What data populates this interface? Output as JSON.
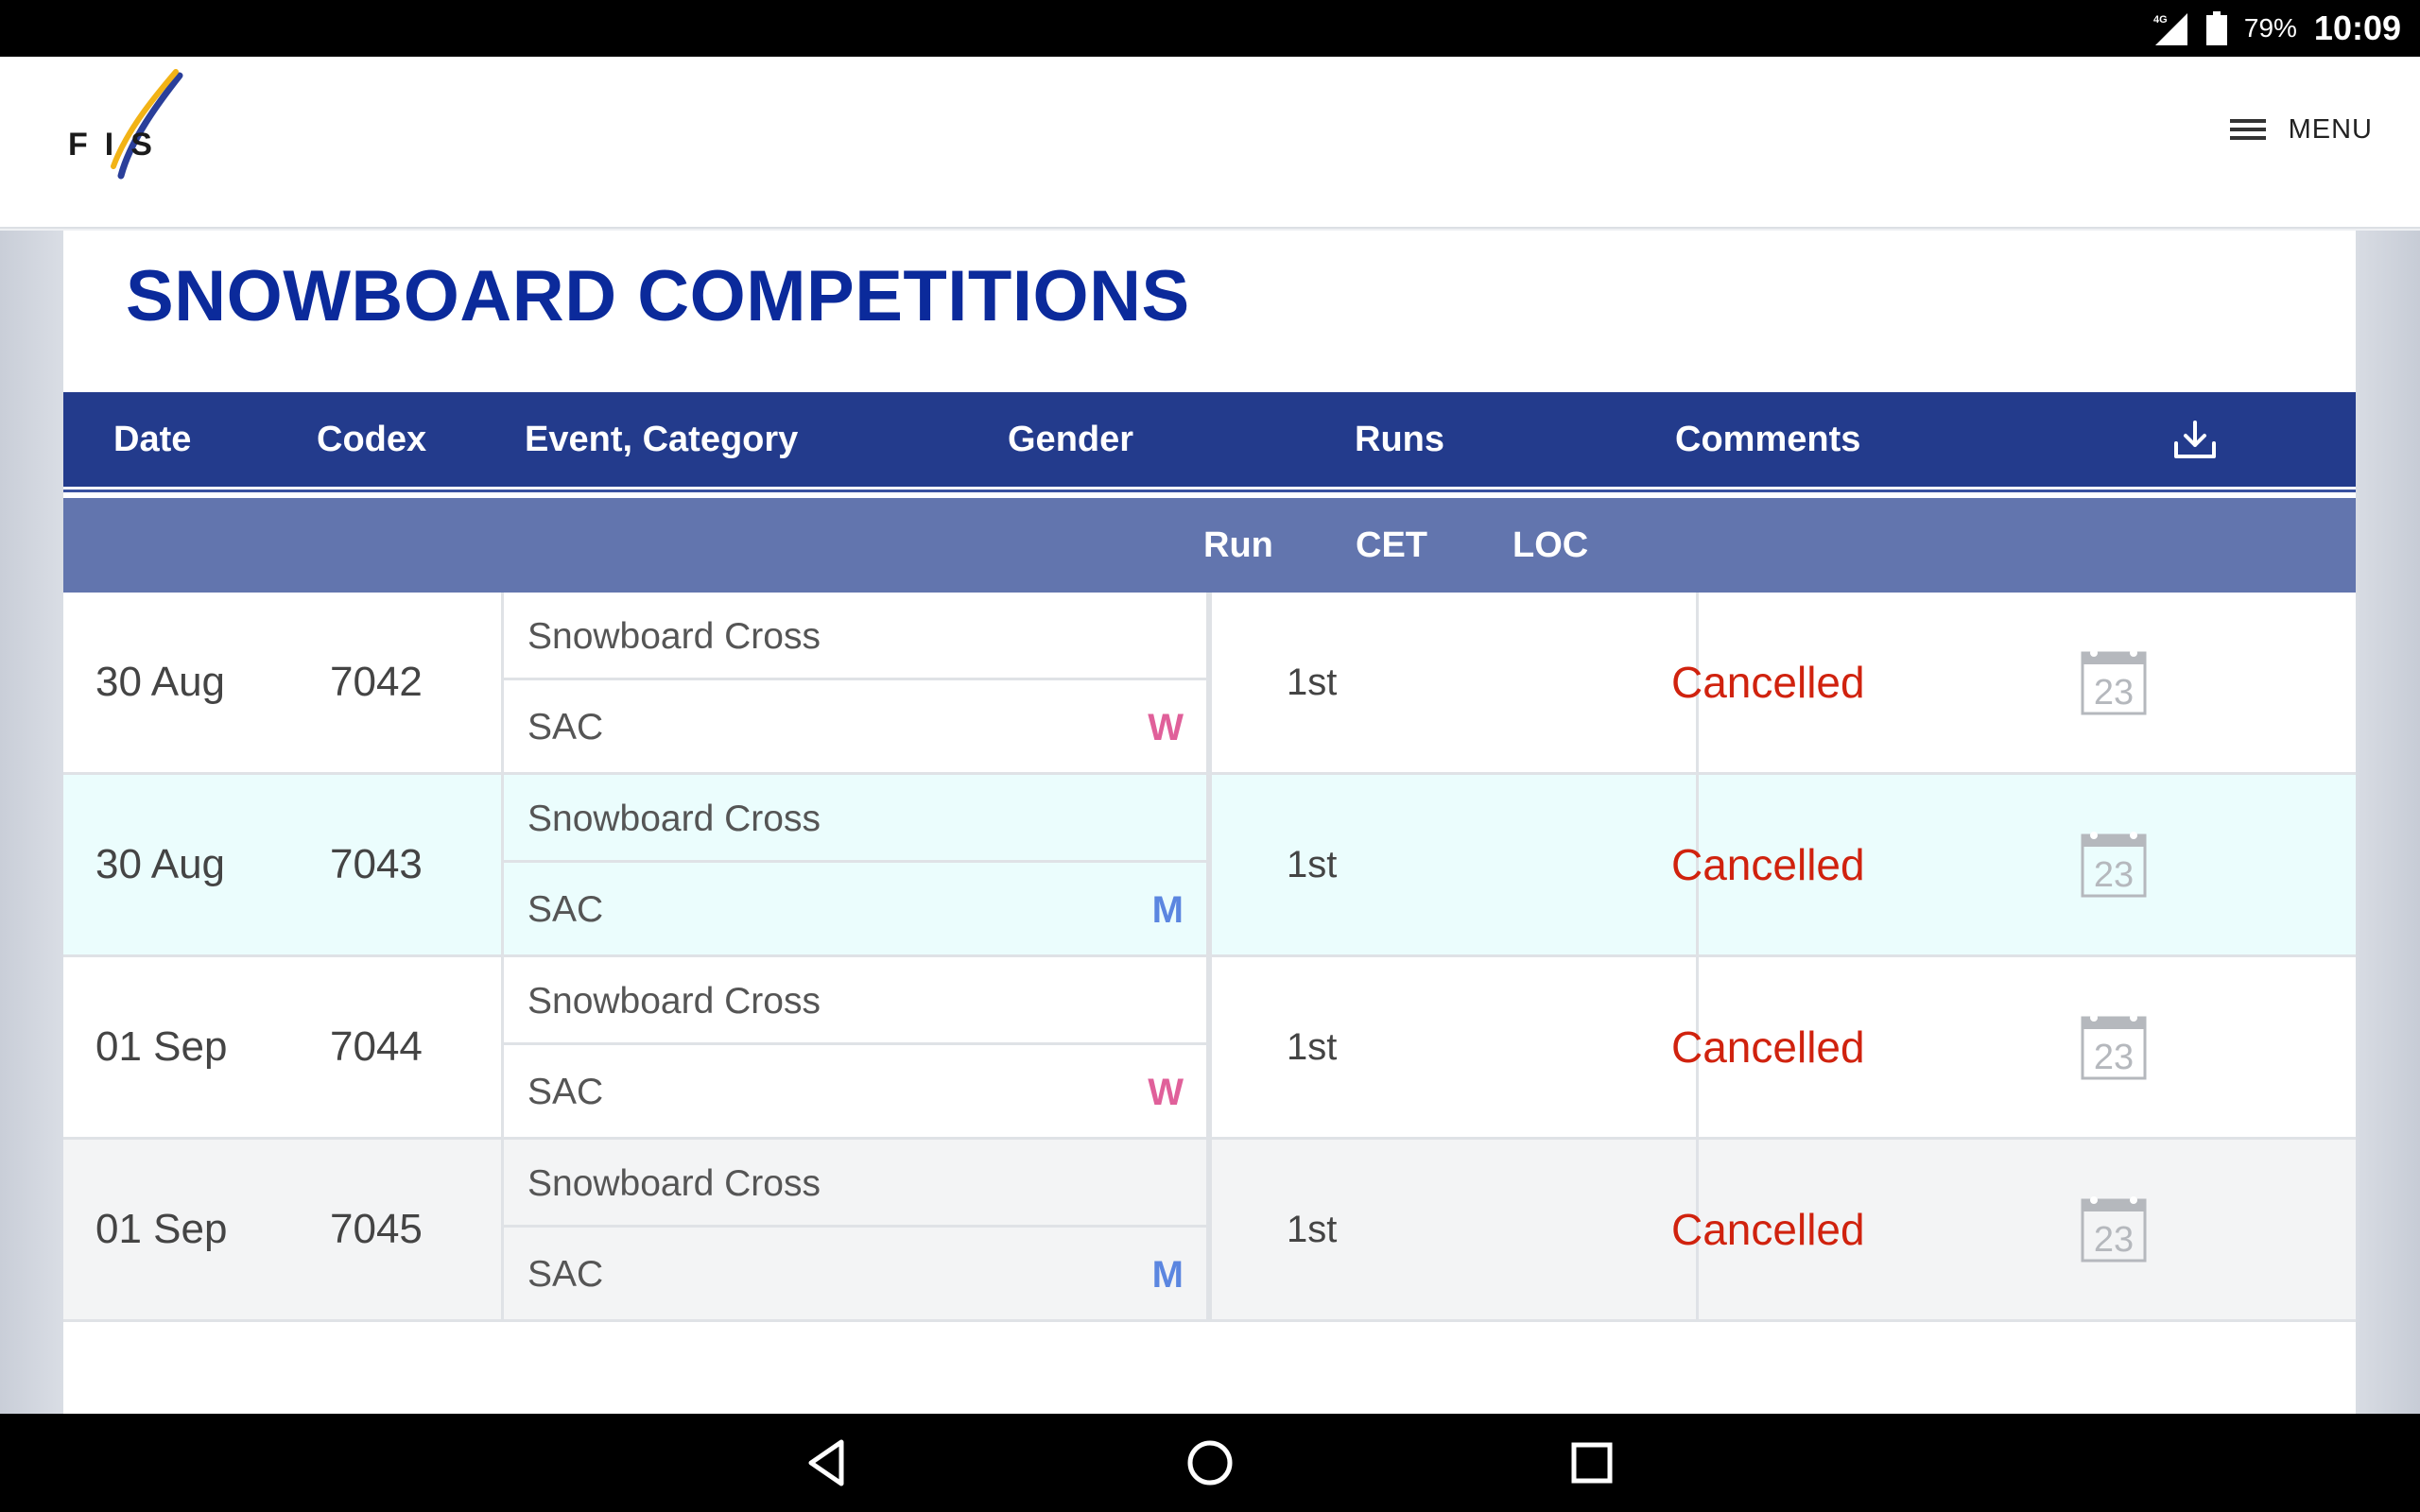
{
  "status_bar": {
    "network_label": "4G",
    "battery": "79%",
    "time": "10:09"
  },
  "header": {
    "logo_text": "FIS",
    "menu_label": "MENU"
  },
  "page": {
    "title": "SNOWBOARD COMPETITIONS"
  },
  "table": {
    "headers": {
      "date": "Date",
      "codex": "Codex",
      "event": "Event, Category",
      "gender": "Gender",
      "runs": "Runs",
      "comments": "Comments"
    },
    "subheaders": {
      "run": "Run",
      "cet": "CET",
      "loc": "LOC"
    },
    "rows": [
      {
        "date": "30 Aug",
        "codex": "7042",
        "event": "Snowboard Cross",
        "category": "SAC",
        "gender": "W",
        "run": "1st",
        "comment": "Cancelled",
        "calendar_day": "23"
      },
      {
        "date": "30 Aug",
        "codex": "7043",
        "event": "Snowboard Cross",
        "category": "SAC",
        "gender": "M",
        "run": "1st",
        "comment": "Cancelled",
        "calendar_day": "23"
      },
      {
        "date": "01 Sep",
        "codex": "7044",
        "event": "Snowboard Cross",
        "category": "SAC",
        "gender": "W",
        "run": "1st",
        "comment": "Cancelled",
        "calendar_day": "23"
      },
      {
        "date": "01 Sep",
        "codex": "7045",
        "event": "Snowboard Cross",
        "category": "SAC",
        "gender": "M",
        "run": "1st",
        "comment": "Cancelled",
        "calendar_day": "23"
      }
    ]
  },
  "colors": {
    "title_blue": "#0b2a9b",
    "header_blue": "#233b8c",
    "subheader_blue": "#6275ae",
    "cancelled_red": "#d0220e",
    "gender_w": "#e0609a",
    "gender_m": "#5b86e0"
  },
  "icons": {
    "download": "download-icon",
    "calendar": "calendar-icon",
    "menu": "hamburger-icon"
  }
}
